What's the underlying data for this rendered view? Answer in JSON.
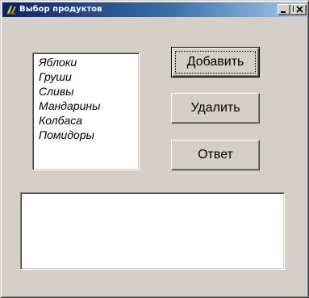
{
  "window": {
    "title": "Выбор продуктов",
    "icon": "delphi-app-icon",
    "controls": {
      "minimize": "minimize-icon",
      "maximize": "maximize-icon",
      "close": "close-icon"
    }
  },
  "products": {
    "items": [
      {
        "label": "Яблоки"
      },
      {
        "label": "Груши"
      },
      {
        "label": "Сливы"
      },
      {
        "label": "Мандарины"
      },
      {
        "label": "Колбаса"
      },
      {
        "label": "Помидоры"
      }
    ]
  },
  "buttons": {
    "add": "Добавить",
    "delete": "Удалить",
    "answer": "Ответ"
  },
  "output": {
    "value": ""
  },
  "colors": {
    "face": "#d4d0c8",
    "title_start": "#0a246a",
    "title_end": "#a6caf0"
  }
}
